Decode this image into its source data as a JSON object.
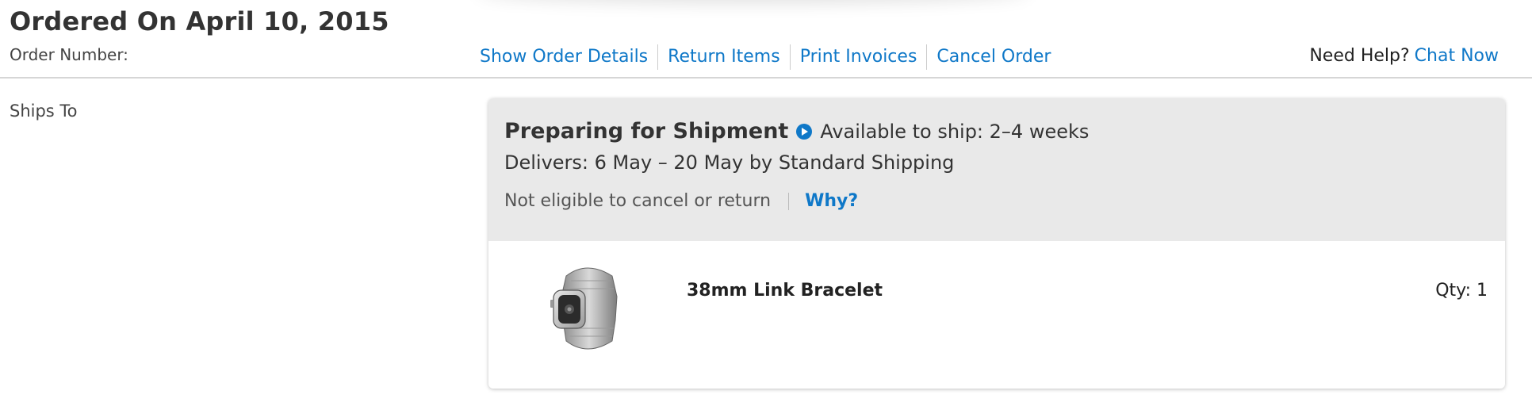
{
  "order": {
    "title": "Ordered On April 10, 2015",
    "number_label": "Order Number:"
  },
  "actions": [
    "Show Order Details",
    "Return Items",
    "Print Invoices",
    "Cancel Order"
  ],
  "help": {
    "text": "Need Help?",
    "link": "Chat Now"
  },
  "ships_to_label": "Ships To",
  "shipment": {
    "status": "Preparing for Shipment",
    "availability": "Available to ship: 2–4 weeks",
    "delivers": "Delivers: 6 May – 20 May by Standard Shipping",
    "eligibility": "Not eligible to cancel or return",
    "why_link": "Why?",
    "item": {
      "name": "38mm Link Bracelet",
      "qty": "Qty: 1"
    }
  },
  "colors": {
    "link": "#0f78c8",
    "header_bg": "#e9e9e9"
  }
}
